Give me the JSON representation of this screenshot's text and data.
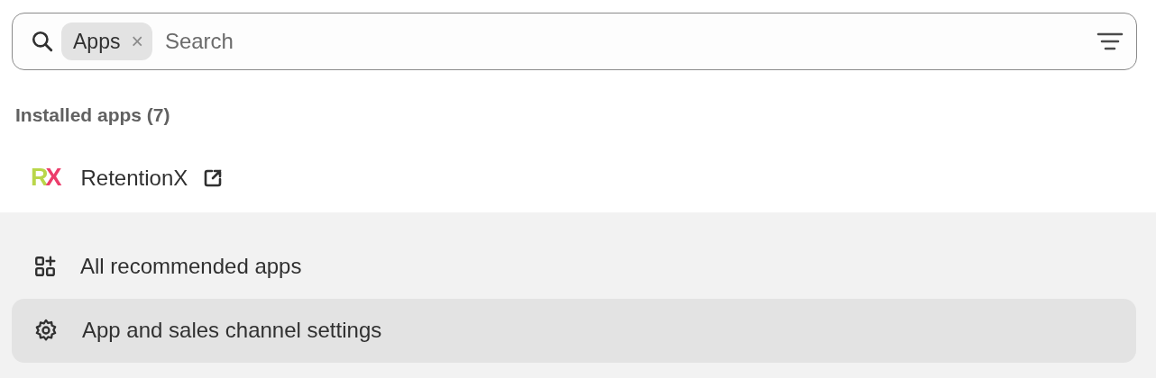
{
  "search": {
    "filter_chip": "Apps",
    "chip_remove": "×",
    "placeholder": "Search"
  },
  "installed": {
    "heading": "Installed apps (7)",
    "apps": [
      {
        "logo_letters": [
          "R",
          "X"
        ],
        "name": "RetentionX",
        "external": true
      }
    ]
  },
  "actions": [
    {
      "kind": "grid",
      "label": "All recommended apps",
      "selected": false
    },
    {
      "kind": "settings",
      "label": "App and sales channel settings",
      "selected": true
    }
  ]
}
